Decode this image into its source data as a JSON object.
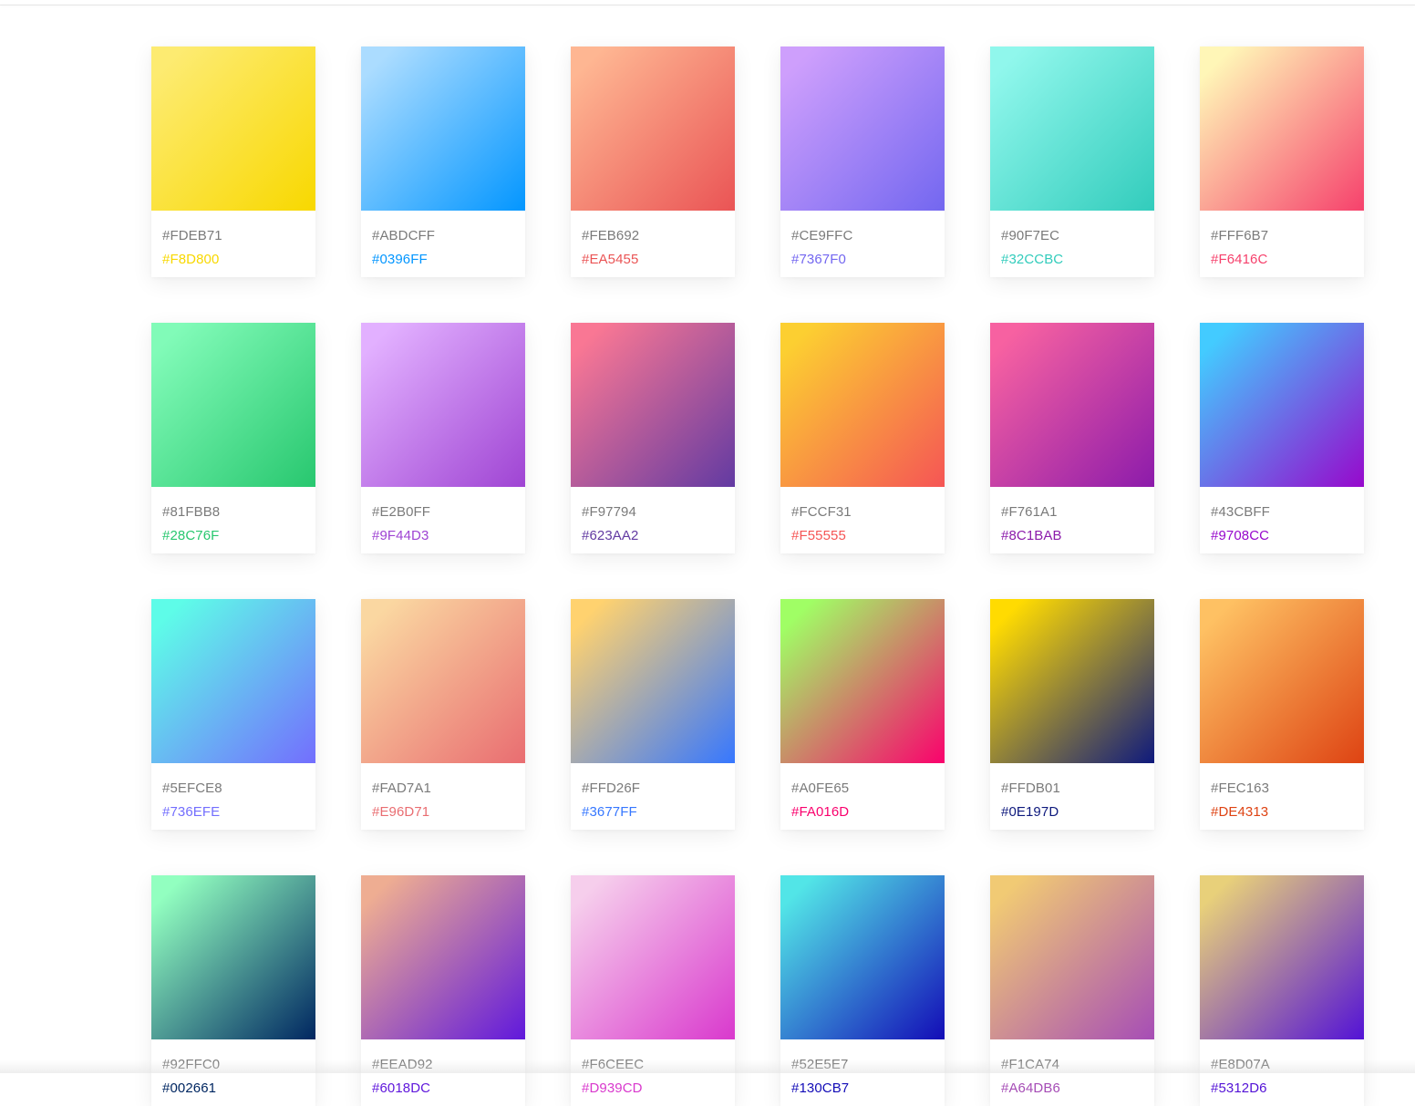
{
  "palettes": [
    {
      "start": "#FDEB71",
      "end": "#F8D800"
    },
    {
      "start": "#ABDCFF",
      "end": "#0396FF"
    },
    {
      "start": "#FEB692",
      "end": "#EA5455"
    },
    {
      "start": "#CE9FFC",
      "end": "#7367F0"
    },
    {
      "start": "#90F7EC",
      "end": "#32CCBC"
    },
    {
      "start": "#FFF6B7",
      "end": "#F6416C"
    },
    {
      "start": "#81FBB8",
      "end": "#28C76F"
    },
    {
      "start": "#E2B0FF",
      "end": "#9F44D3"
    },
    {
      "start": "#F97794",
      "end": "#623AA2"
    },
    {
      "start": "#FCCF31",
      "end": "#F55555"
    },
    {
      "start": "#F761A1",
      "end": "#8C1BAB"
    },
    {
      "start": "#43CBFF",
      "end": "#9708CC"
    },
    {
      "start": "#5EFCE8",
      "end": "#736EFE"
    },
    {
      "start": "#FAD7A1",
      "end": "#E96D71"
    },
    {
      "start": "#FFD26F",
      "end": "#3677FF"
    },
    {
      "start": "#A0FE65",
      "end": "#FA016D"
    },
    {
      "start": "#FFDB01",
      "end": "#0E197D"
    },
    {
      "start": "#FEC163",
      "end": "#DE4313"
    },
    {
      "start": "#92FFC0",
      "end": "#002661"
    },
    {
      "start": "#EEAD92",
      "end": "#6018DC"
    },
    {
      "start": "#F6CEEC",
      "end": "#D939CD"
    },
    {
      "start": "#52E5E7",
      "end": "#130CB7"
    },
    {
      "start": "#F1CA74",
      "end": "#A64DB6"
    },
    {
      "start": "#E8D07A",
      "end": "#5312D6"
    }
  ]
}
